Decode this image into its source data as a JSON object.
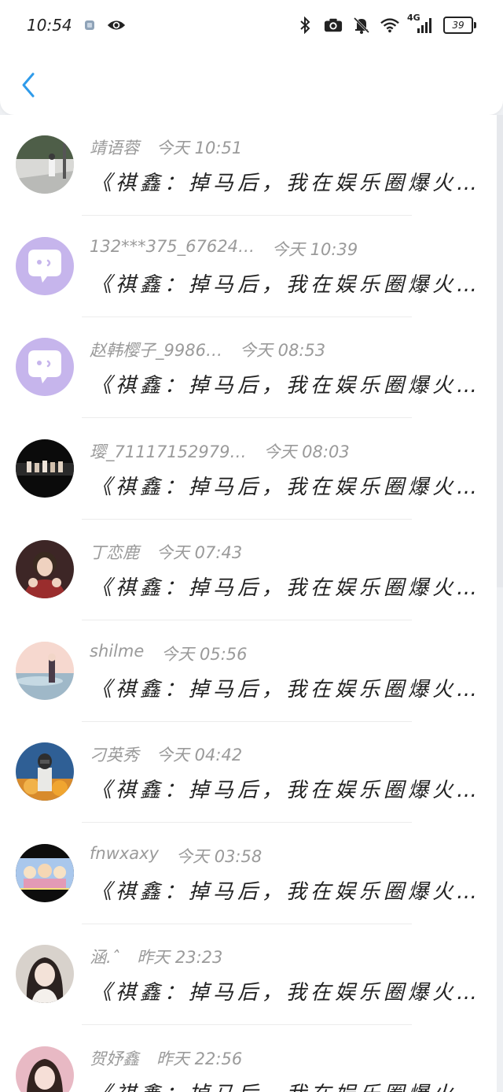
{
  "status_bar": {
    "time": "10:54",
    "battery": "39",
    "network": "4G",
    "icons": [
      "gallery-icon",
      "eye-icon",
      "bluetooth-icon",
      "camera-icon",
      "bell-off-icon",
      "wifi-icon",
      "signal-icon",
      "battery-icon"
    ]
  },
  "header": {
    "back_icon": "chevron-left-icon",
    "accent_color": "#2f9bea"
  },
  "messages": [
    {
      "name": "靖语蓉",
      "time": "今天 10:51",
      "preview": "《祺鑫：掉马后，我在娱乐圈爆火…",
      "avatar": "photo-street"
    },
    {
      "name": "132***375_67624…",
      "time": "今天 10:39",
      "preview": "《祺鑫：掉马后，我在娱乐圈爆火…",
      "avatar": "default-chat-purple"
    },
    {
      "name": "赵韩樱子_9986…",
      "time": "今天 08:53",
      "preview": "《祺鑫：掉马后，我在娱乐圈爆火…",
      "avatar": "default-chat-purple"
    },
    {
      "name": "璎_71117152979…",
      "time": "今天 08:03",
      "preview": "《祺鑫：掉马后，我在娱乐圈爆火…",
      "avatar": "photo-group-stage"
    },
    {
      "name": "丁恋鹿",
      "time": "今天 07:43",
      "preview": "《祺鑫：掉马后，我在娱乐圈爆火…",
      "avatar": "photo-person-red"
    },
    {
      "name": "shilme",
      "time": "今天 05:56",
      "preview": "《祺鑫：掉马后，我在娱乐圈爆火…",
      "avatar": "photo-anime-sky"
    },
    {
      "name": "刁英秀",
      "time": "今天 04:42",
      "preview": "《祺鑫：掉马后，我在娱乐圈爆火…",
      "avatar": "photo-game-soldier"
    },
    {
      "name": "fnwxaxy",
      "time": "今天 03:58",
      "preview": "《祺鑫：掉马后，我在娱乐圈爆火…",
      "avatar": "photo-cartoon-group"
    },
    {
      "name": "涵.ˆ",
      "time": "昨天 23:23",
      "preview": "《祺鑫：掉马后，我在娱乐圈爆火…",
      "avatar": "photo-girl-portrait"
    },
    {
      "name": "贺妤鑫",
      "time": "昨天 22:56",
      "preview": "《祺鑫：掉马后，我在娱乐圈爆火…",
      "avatar": "photo-girl-pink"
    }
  ]
}
